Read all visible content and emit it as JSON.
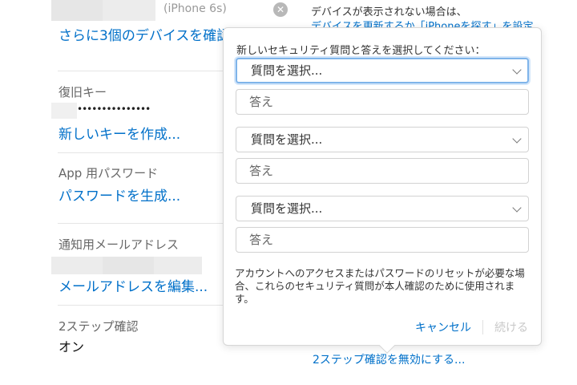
{
  "devices": {
    "device_model": "(iPhone 6s)",
    "more_devices_link": "さらに3個のデバイスを確認",
    "help_line1": "デバイスが表示されない場合は、",
    "help_line2_link": "デバイスを更新するか「iPhoneを探す」を設定"
  },
  "recovery_key": {
    "label": "復旧キー",
    "masked_value": "•••••••••••••••",
    "create_link": "新しいキーを作成..."
  },
  "app_password": {
    "label": "App 用パスワード",
    "generate_link": "パスワードを生成..."
  },
  "notification_email": {
    "label": "通知用メールアドレス",
    "edit_link": "メールアドレスを編集..."
  },
  "two_step": {
    "label": "2ステップ確認",
    "status": "オン",
    "disable_link": "2ステップ確認を無効にする..."
  },
  "popover": {
    "instruction": "新しいセキュリティ質問と答えを選択してください：",
    "questions": [
      {
        "select_label": "質問を選択...",
        "answer_placeholder": "答え"
      },
      {
        "select_label": "質問を選択...",
        "answer_placeholder": "答え"
      },
      {
        "select_label": "質問を選択...",
        "answer_placeholder": "答え"
      }
    ],
    "note": "アカウントへのアクセスまたはパスワードのリセットが必要な場合、これらのセキュリティ質問が本人確認のために使用されます。",
    "cancel_label": "キャンセル",
    "continue_label": "続ける"
  }
}
